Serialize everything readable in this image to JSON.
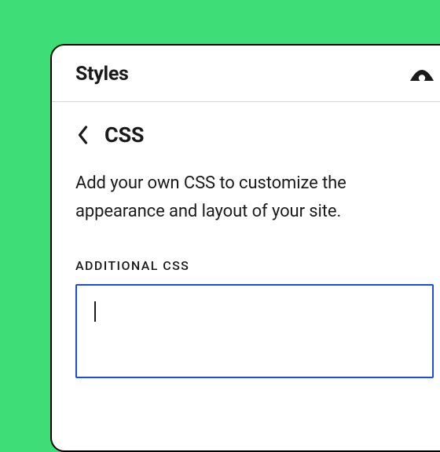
{
  "panel": {
    "title": "Styles"
  },
  "section": {
    "title": "CSS",
    "description": "Add your own CSS to customize the appearance and layout of your site."
  },
  "field": {
    "label": "ADDITIONAL CSS",
    "value": ""
  },
  "icons": {
    "preview": "eye-icon",
    "back": "chevron-left-icon"
  }
}
